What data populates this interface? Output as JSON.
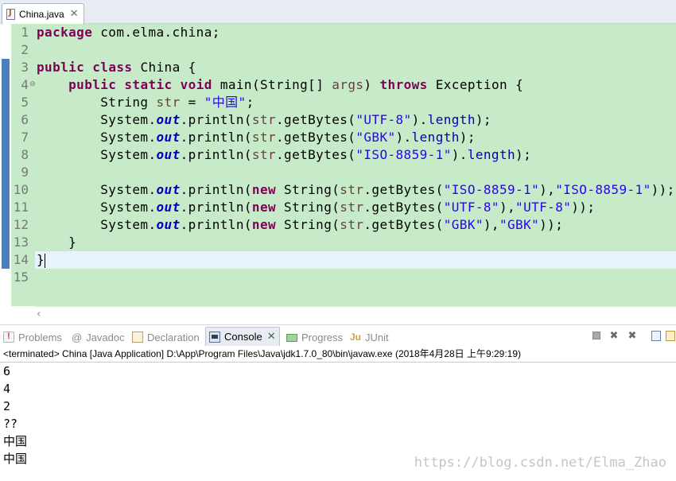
{
  "editor": {
    "tab_title": "China.java",
    "tab_close": "✕",
    "line_numbers": [
      "1",
      "2",
      "3",
      "4",
      "5",
      "6",
      "7",
      "8",
      "9",
      "10",
      "11",
      "12",
      "13",
      "14",
      "15"
    ],
    "fold_marker": "⊖"
  },
  "views": {
    "tabs": [
      {
        "label": "Problems",
        "icon": "problems-icon"
      },
      {
        "label": "Javadoc",
        "icon": "at-sign-icon",
        "icon_text": "@"
      },
      {
        "label": "Declaration",
        "icon": "declaration-icon"
      },
      {
        "label": "Console",
        "icon": "console-icon",
        "active": true
      },
      {
        "label": "Progress",
        "icon": "progress-icon"
      },
      {
        "label": "JUnit",
        "icon": "junit-icon",
        "icon_text": "Ju"
      }
    ],
    "console_close": "✕"
  },
  "console": {
    "header": "<terminated> China [Java Application] D:\\App\\Program Files\\Java\\jdk1.7.0_80\\bin\\javaw.exe (2018年4月28日 上午9:29:19)",
    "output": [
      "6",
      "4",
      "2",
      "??",
      "中国",
      "中国"
    ]
  },
  "watermark": "https://blog.csdn.net/Elma_Zhao",
  "colors": {
    "code_background": "#c7ebc9",
    "keyword": "#7f0055",
    "string": "#2a00ff",
    "static_field": "#0000c0",
    "current_line": "#e8f2fe"
  }
}
